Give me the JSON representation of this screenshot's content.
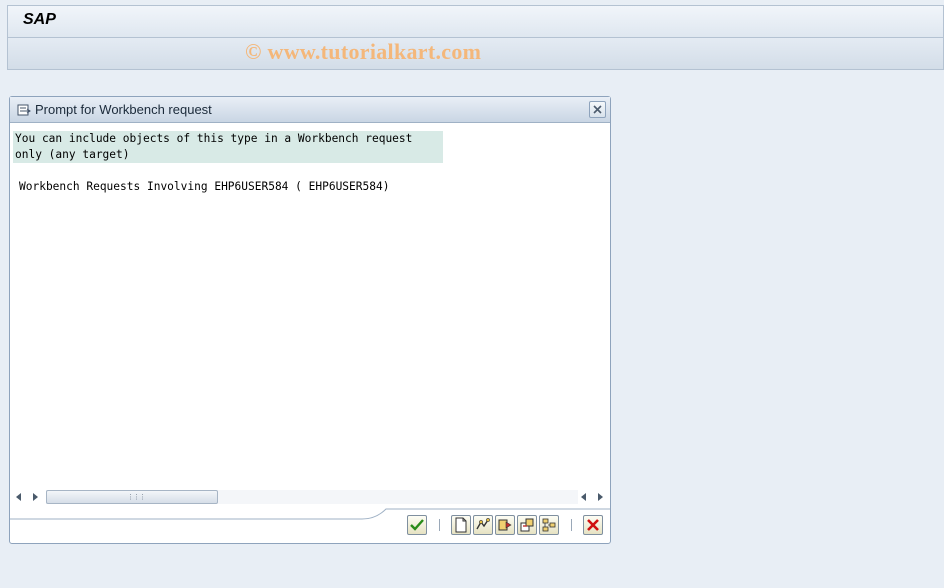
{
  "window": {
    "title": "SAP"
  },
  "watermark": "© www.tutorialkart.com",
  "dialog": {
    "title": "Prompt for Workbench request",
    "info_line_1": "You can include objects of this type in a Workbench request",
    "info_line_2": "only (any target)",
    "request_line": "Workbench Requests Involving EHP6USER584 ( EHP6USER584)"
  },
  "icons": {
    "dialog": "dialog-icon",
    "close": "close-icon",
    "continue": "checkmark-icon",
    "create": "new-document-icon",
    "own_requests": "own-requests-icon",
    "display": "display-request-icon",
    "change": "change-request-icon",
    "structure": "structure-icon",
    "cancel": "cancel-icon"
  },
  "colors": {
    "info_highlight": "#d8eae6",
    "watermark": "#f4b77a",
    "cancel_red": "#d01010",
    "check_green": "#2a8c1a"
  }
}
